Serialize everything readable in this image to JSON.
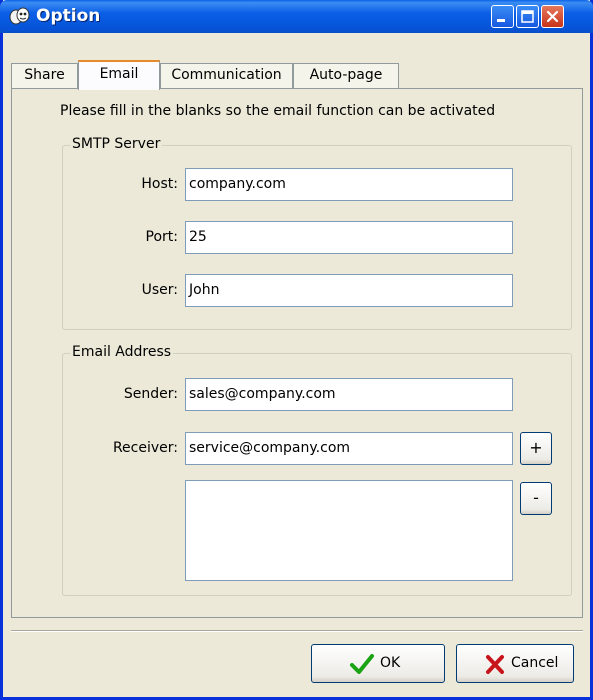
{
  "window": {
    "title": "Option"
  },
  "tabs": [
    {
      "label": "Share"
    },
    {
      "label": "Email"
    },
    {
      "label": "Communication"
    },
    {
      "label": "Auto-page"
    }
  ],
  "instruction": "Please fill in the blanks so the email function can be activated",
  "smtp": {
    "group_label": "SMTP Server",
    "host_label": "Host:",
    "host_value": "company.com",
    "port_label": "Port:",
    "port_value": "25",
    "user_label": "User:",
    "user_value": "John"
  },
  "email": {
    "group_label": "Email Address",
    "sender_label": "Sender:",
    "sender_value": "sales@company.com",
    "receiver_label": "Receiver:",
    "receiver_value": "service@company.com",
    "add_label": "+",
    "remove_label": "-"
  },
  "buttons": {
    "ok_label": "OK",
    "cancel_label": "Cancel"
  }
}
